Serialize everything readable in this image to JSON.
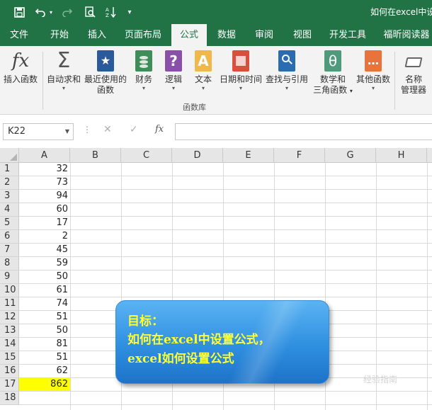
{
  "window": {
    "title": "如何在excel中设"
  },
  "qat": {
    "save": "save-icon",
    "undo": "undo-icon",
    "redo": "redo-icon",
    "print_preview": "print-preview-icon",
    "sort": "sort-icon",
    "customize": "▾"
  },
  "tabs": [
    {
      "label": "文件"
    },
    {
      "label": "开始"
    },
    {
      "label": "插入"
    },
    {
      "label": "页面布局"
    },
    {
      "label": "公式",
      "active": true
    },
    {
      "label": "数据"
    },
    {
      "label": "审阅"
    },
    {
      "label": "视图"
    },
    {
      "label": "开发工具"
    },
    {
      "label": "福昕阅读器"
    }
  ],
  "ribbon": {
    "insert_function": {
      "glyph": "fx",
      "label": "插入函数"
    },
    "autosum": {
      "glyph": "Σ",
      "label": "自动求和"
    },
    "recent": {
      "line1": "最近使用的",
      "line2": "函数"
    },
    "financial": {
      "label": "财务"
    },
    "logical": {
      "glyph": "?",
      "label": "逻辑"
    },
    "text": {
      "glyph": "A",
      "label": "文本"
    },
    "datetime": {
      "label": "日期和时间"
    },
    "lookup": {
      "label": "查找与引用"
    },
    "math": {
      "glyph": "θ",
      "line1": "数学和",
      "line2": "三角函数"
    },
    "more": {
      "glyph": "…",
      "label": "其他函数"
    },
    "names": {
      "line1": "名称",
      "line2": "管理器"
    },
    "group_label": "函数库",
    "caret": "▾"
  },
  "formula_bar": {
    "name_box": "K22",
    "dots": "⋮",
    "cancel": "✕",
    "enter": "✓",
    "fx": "fx",
    "value": ""
  },
  "columns": [
    "A",
    "B",
    "C",
    "D",
    "E",
    "F",
    "G",
    "H"
  ],
  "rows": [
    {
      "num": "1",
      "a": "32"
    },
    {
      "num": "2",
      "a": "73"
    },
    {
      "num": "3",
      "a": "94"
    },
    {
      "num": "4",
      "a": "60"
    },
    {
      "num": "5",
      "a": "17"
    },
    {
      "num": "6",
      "a": "2"
    },
    {
      "num": "7",
      "a": "45"
    },
    {
      "num": "8",
      "a": "59"
    },
    {
      "num": "9",
      "a": "50"
    },
    {
      "num": "10",
      "a": "61"
    },
    {
      "num": "11",
      "a": "74"
    },
    {
      "num": "12",
      "a": "51"
    },
    {
      "num": "13",
      "a": "50"
    },
    {
      "num": "14",
      "a": "81"
    },
    {
      "num": "15",
      "a": "51"
    },
    {
      "num": "16",
      "a": "62"
    },
    {
      "num": "17",
      "a": "862",
      "highlight": "#ffff00"
    },
    {
      "num": "18",
      "a": ""
    }
  ],
  "callout": {
    "line1": "目标：",
    "line2": "如何在excel中设置公式，",
    "line3": "excel如何设置公式"
  },
  "watermark": "经验指南",
  "colors": {
    "brand": "#217346",
    "callout_text": "#ffff33",
    "callout_bg": "#2f8fe0",
    "highlight": "#ffff00"
  }
}
